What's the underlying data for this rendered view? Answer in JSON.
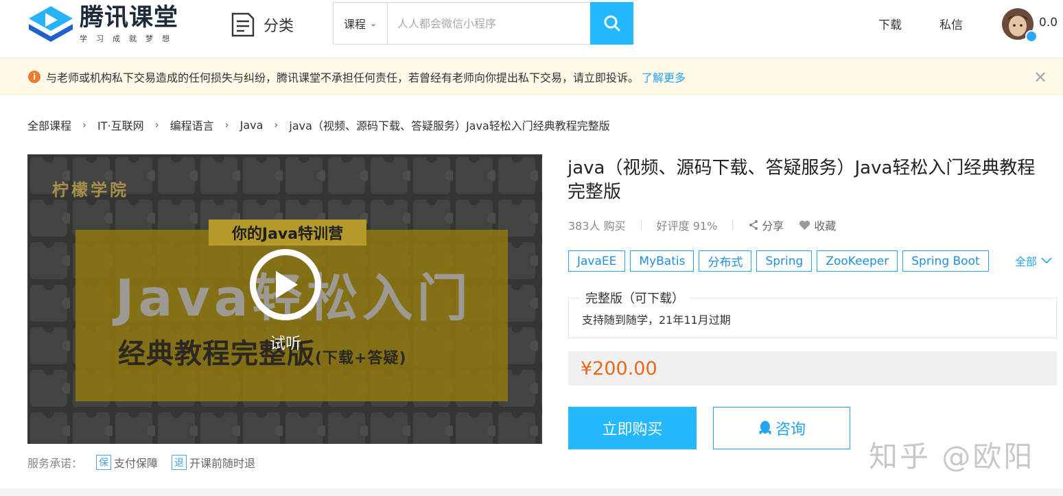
{
  "header": {
    "logo_title": "腾讯课堂",
    "logo_subtitle": "学习成就梦想",
    "category_label": "分类",
    "search": {
      "scope_label": "课程",
      "placeholder": "人人都会微信小程序"
    },
    "nav": {
      "download_label": "下载",
      "message_label": "私信"
    },
    "balance": "0.0"
  },
  "notice": {
    "text": "与老师或机构私下交易造成的任何损失与纠纷，腾讯课堂不承担任何责任，若曾经有老师向你提出私下交易，请立即投诉。",
    "link_text": "了解更多"
  },
  "breadcrumb": [
    "全部课程",
    "IT·互联网",
    "编程语言",
    "Java",
    "java（视频、源码下载、答疑服务）Java轻松入门经典教程完整版"
  ],
  "video": {
    "brand": "柠檬学院",
    "tagline": "你的Java特训营",
    "headline": "Java轻松入门",
    "subheadline": "经典教程完整版",
    "subheadline_suffix": "(下载+答疑)",
    "play_label": "试听"
  },
  "service": {
    "label": "服务承诺：",
    "items": [
      {
        "badge": "保",
        "text": "支付保障"
      },
      {
        "badge": "退",
        "text": "开课前随时退"
      }
    ]
  },
  "course": {
    "title": "java（视频、源码下载、答疑服务）Java轻松入门经典教程完整版",
    "buyers": "383人 购买",
    "rating": "好评度 91%",
    "share_label": "分享",
    "favorite_label": "收藏",
    "tags": [
      "JavaEE",
      "MyBatis",
      "分布式",
      "Spring",
      "ZooKeeper",
      "Spring Boot"
    ],
    "tags_all_label": "全部",
    "package_title": "完整版（可下载）",
    "package_desc": "支持随到随学，21年11月过期",
    "price": "¥200.00",
    "buy_label": "立即购买",
    "consult_label": "咨询"
  },
  "watermark": "知乎 @欧阳",
  "colors": {
    "accent": "#23b8ff",
    "link": "#23a3f2",
    "price": "#e66a1c",
    "notice_bg": "#fff9e8"
  }
}
